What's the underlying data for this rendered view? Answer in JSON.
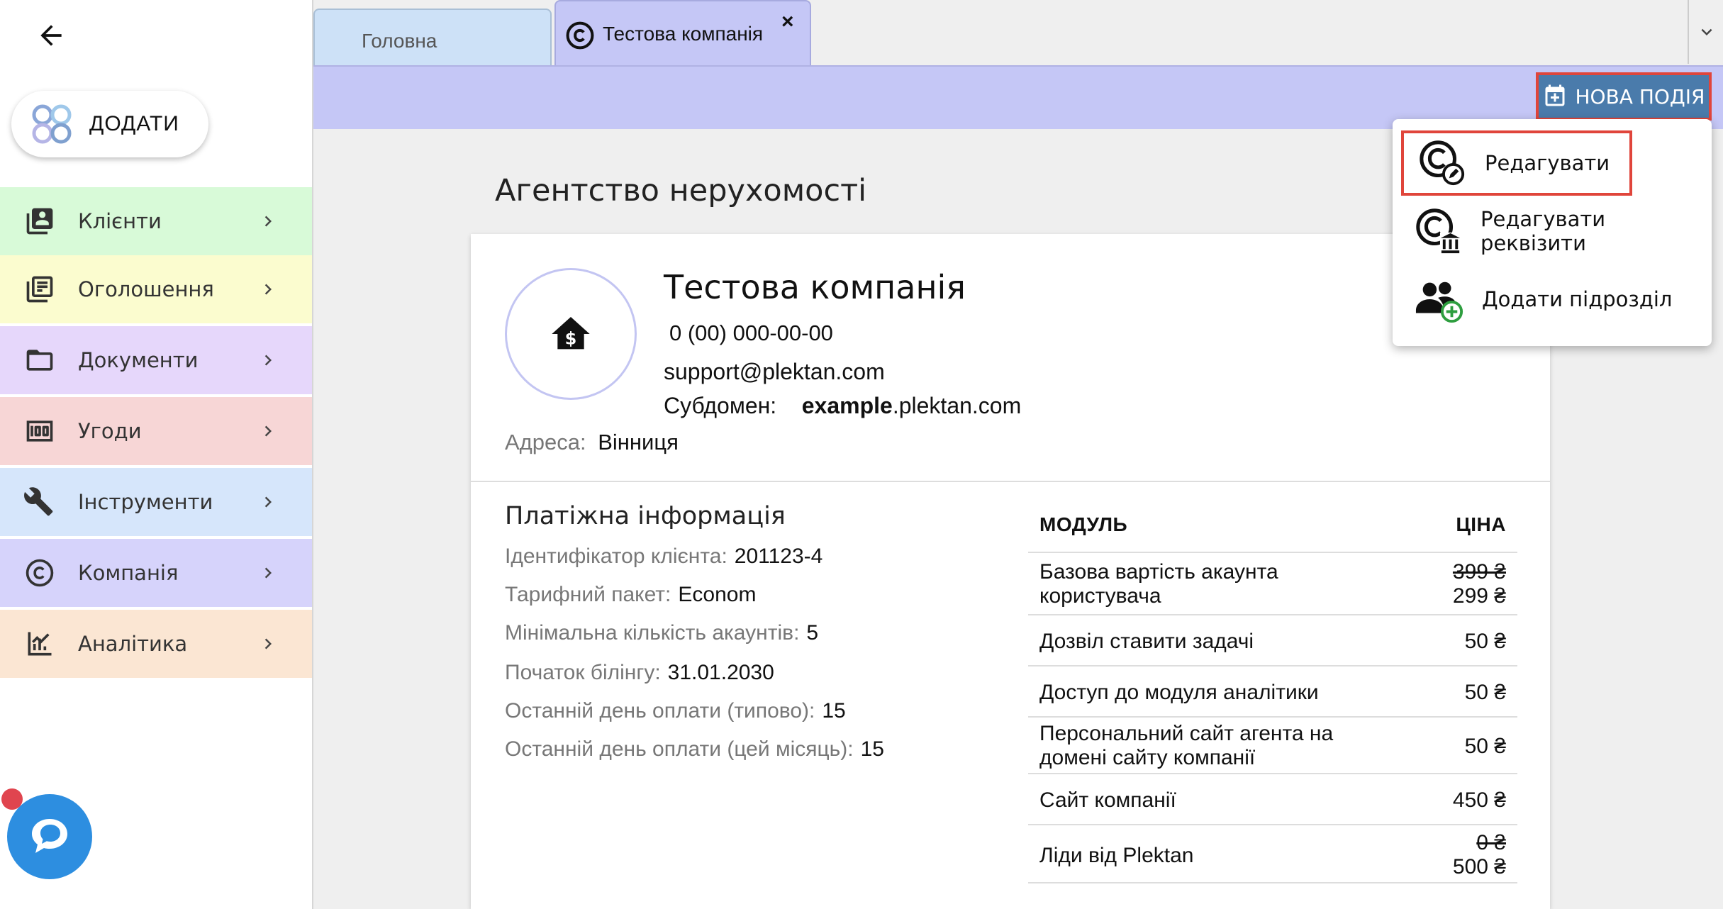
{
  "sidebar": {
    "add_label": "ДОДАТИ",
    "items": [
      {
        "label": "Клієнти",
        "icon": "contacts-icon",
        "color": "#d8fad8"
      },
      {
        "label": "Оголошення",
        "icon": "listings-icon",
        "color": "#fbfccf"
      },
      {
        "label": "Документи",
        "icon": "folder-icon",
        "color": "#e6d7fb"
      },
      {
        "label": "Угоди",
        "icon": "money-icon",
        "color": "#f7d6d6"
      },
      {
        "label": "Інструменти",
        "icon": "tools-icon",
        "color": "#d6e6fb"
      },
      {
        "label": "Компанія",
        "icon": "copyright-icon",
        "color": "#d6d3fb"
      },
      {
        "label": "Аналітика",
        "icon": "analytics-icon",
        "color": "#fbe6d3"
      }
    ]
  },
  "tabs": [
    {
      "label": "Головна"
    },
    {
      "label": "Тестова компанія",
      "close": "×"
    }
  ],
  "toolbar": {
    "new_event_label": "НОВА ПОДІЯ"
  },
  "page": {
    "heading": "Агентство нерухомості"
  },
  "company": {
    "name": "Тестова компанія",
    "phone": "0 (00) 000-00-00",
    "email": "support@plektan.com",
    "subdomain_label": "Субдомен:",
    "subdomain_bold": "example",
    "subdomain_rest": ".plektan.com",
    "address_label": "Адреса:",
    "address_value": "Вінниця"
  },
  "billing": {
    "title": "Платіжна інформація",
    "rows": [
      {
        "label": "Ідентифікатор клієнта:",
        "value": "201123-4"
      },
      {
        "label": "Тарифний пакет:",
        "value": "Econom"
      },
      {
        "label": "Мінімальна кількість акаунтів:",
        "value": "5"
      },
      {
        "label": "Початок білінгу:",
        "value": "31.01.2030"
      },
      {
        "label": "Останній день оплати (типово):",
        "value": "15"
      },
      {
        "label": "Останній день оплати (цей місяць):",
        "value": "15"
      }
    ]
  },
  "prices": {
    "col_module": "МОДУЛЬ",
    "col_price": "ЦІНА",
    "rows": [
      {
        "module_line1": "Базова вартість акаунта",
        "module_line2": "користувача",
        "old_price": "399 ₴",
        "price": "299 ₴"
      },
      {
        "module_line1": "Дозвіл ставити задачі",
        "price": "50 ₴"
      },
      {
        "module_line1": "Доступ до модуля аналітики",
        "price": "50 ₴"
      },
      {
        "module_line1": "Персональний сайт агента на",
        "module_line2": "домені сайту компанії",
        "price": "50 ₴"
      },
      {
        "module_line1": "Сайт компанії",
        "price": "450 ₴"
      },
      {
        "module_line1": "Ліди від Plektan",
        "old_price": "0 ₴",
        "price": "500 ₴"
      }
    ]
  },
  "menu": {
    "items": [
      {
        "label": "Редагувати",
        "icon": "company-edit-icon"
      },
      {
        "label": "Редагувати реквізити",
        "icon": "company-bank-icon"
      },
      {
        "label": "Додати підрозділ",
        "icon": "add-group-icon"
      }
    ]
  },
  "colors": {
    "accent_purple": "#c5c7f6",
    "button_blue": "#4a7bab",
    "highlight_red": "#e0453b",
    "chat_blue": "#2d8ee0"
  }
}
